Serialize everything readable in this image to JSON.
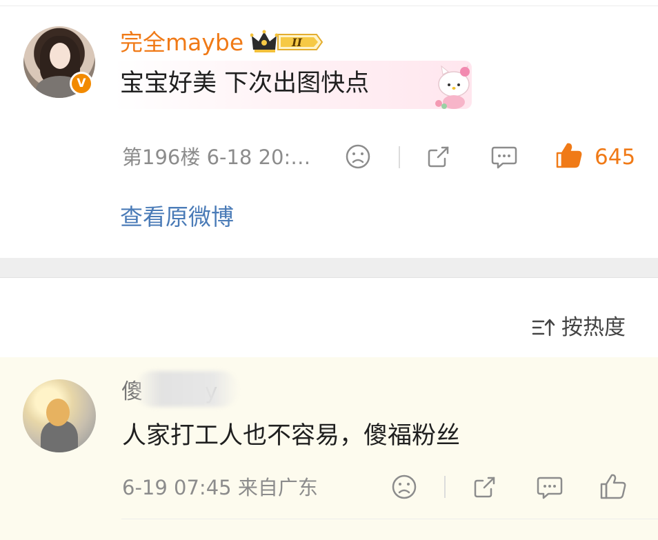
{
  "comment1": {
    "username": "完全maybe",
    "level_badge": "II",
    "text": "宝宝好美 下次出图快点",
    "floor_time": "第196楼 6-18 20:…",
    "likes": "645",
    "view_original": "查看原微博",
    "verified_mark": "V"
  },
  "sort": {
    "label": "按热度"
  },
  "comment2": {
    "username": "傻",
    "username_tail": "y",
    "text": "人家打工人也不容易，傻福粉丝",
    "meta": "6-19 07:45 来自广东"
  },
  "colors": {
    "accent_orange": "#f07a17",
    "link_blue": "#4a7bb7",
    "meta_gray": "#8c8c8c",
    "highlight_bg": "#fdfbee"
  },
  "icons": [
    "dislike-icon",
    "share-icon",
    "reply-icon",
    "like-icon",
    "sort-icon",
    "crown-badge-icon",
    "verified-icon"
  ]
}
